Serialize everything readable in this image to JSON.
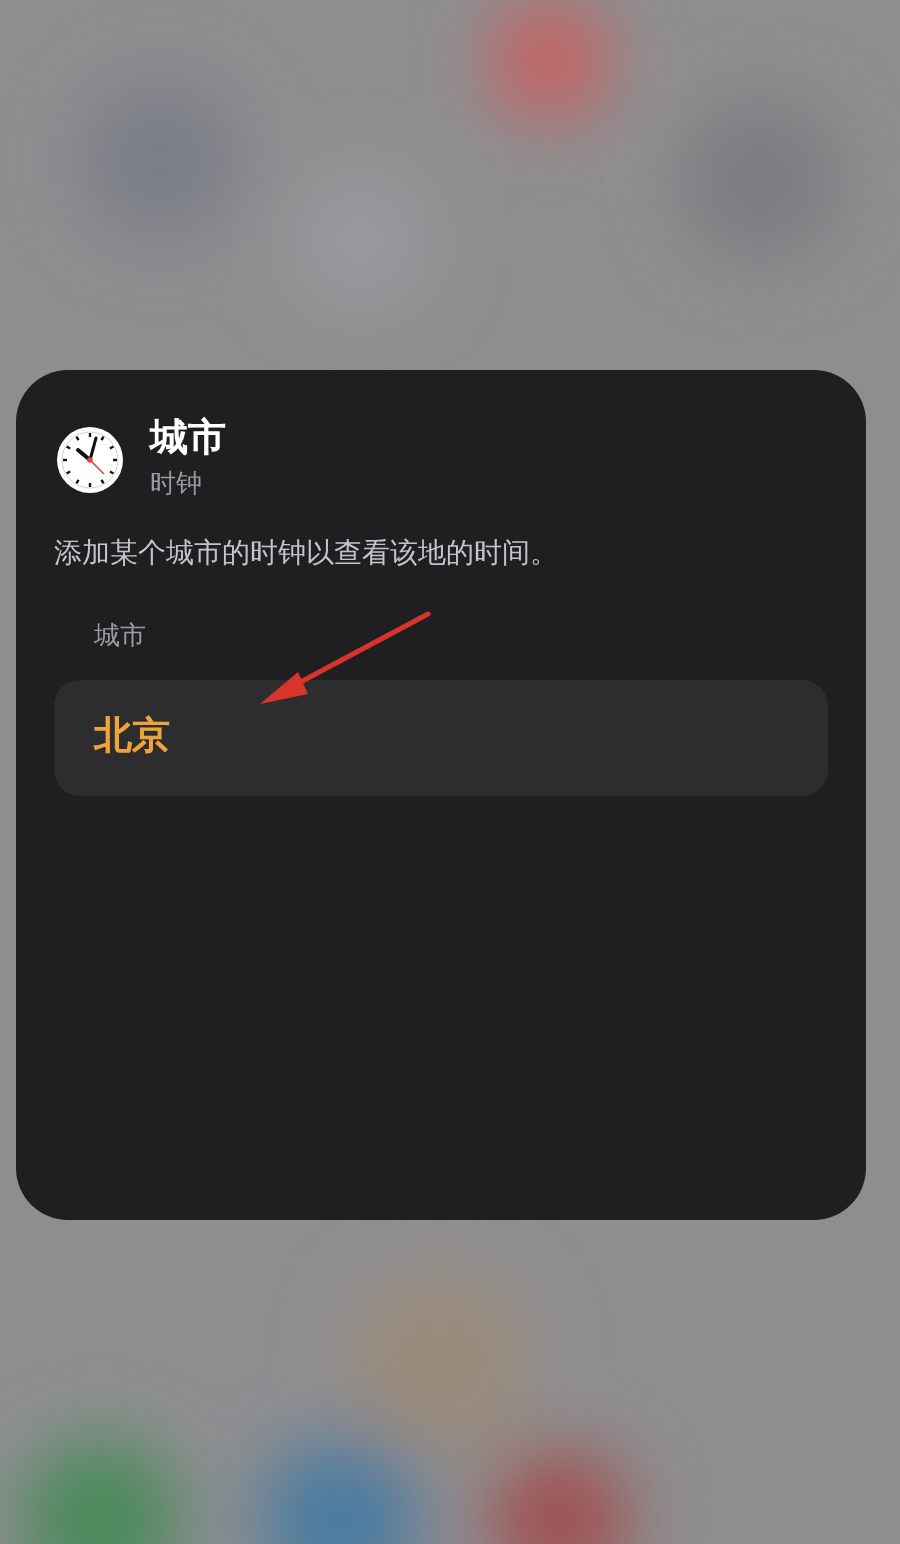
{
  "widget": {
    "title": "城市",
    "subtitle": "时钟",
    "description": "添加某个城市的时钟以查看该地的时间。",
    "field_label": "城市",
    "value": "北京"
  }
}
